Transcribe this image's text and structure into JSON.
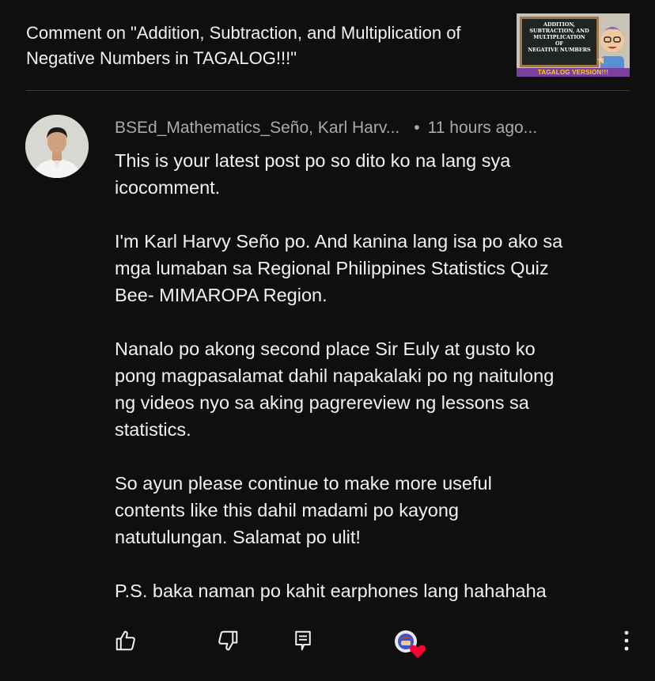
{
  "header": {
    "title": "Comment on \"Addition, Subtraction, and Multiplication of Negative Numbers in TAGALOG!!!\""
  },
  "thumbnail": {
    "lines": [
      "ADDITION,",
      "SUBTRACTION, AND",
      "MULTIPLICATION",
      "OF",
      "NEGATIVE NUMBERS"
    ],
    "banner": "TAGALOG VERSION!!!"
  },
  "comment": {
    "author": "BSEd_Mathematics_Seño, Karl Harv...",
    "separator": "•",
    "time": "11 hours ago...",
    "text": "This is your latest post po so dito ko na lang sya\nicocomment.\n\nI'm Karl Harvy Seño po. And kanina lang isa po ako sa\nmga lumaban sa Regional Philippines Statistics Quiz\nBee- MIMAROPA Region.\n\nNanalo po akong second place Sir Euly at gusto ko\npong magpasalamat dahil napakalaki po ng naitulong\nng videos nyo sa aking pagrereview ng lessons sa\nstatistics.\n\nSo ayun please continue to make more useful\ncontents like this dahil madami po kayong\nnatutulungan. Salamat po ulit!\n\nP.S. baka naman po kahit earphones lang hahahaha"
  },
  "actions": {
    "like_icon": "thumbs-up-icon",
    "dislike_icon": "thumbs-down-icon",
    "reply_icon": "reply-icon",
    "creator_heart_icon": "creator-heart-icon",
    "more_icon": "more-vertical-icon"
  },
  "colors": {
    "background": "#0f0f0f",
    "text": "#f1f1f1",
    "secondary_text": "#aaaaaa",
    "heart": "#ff0033"
  }
}
